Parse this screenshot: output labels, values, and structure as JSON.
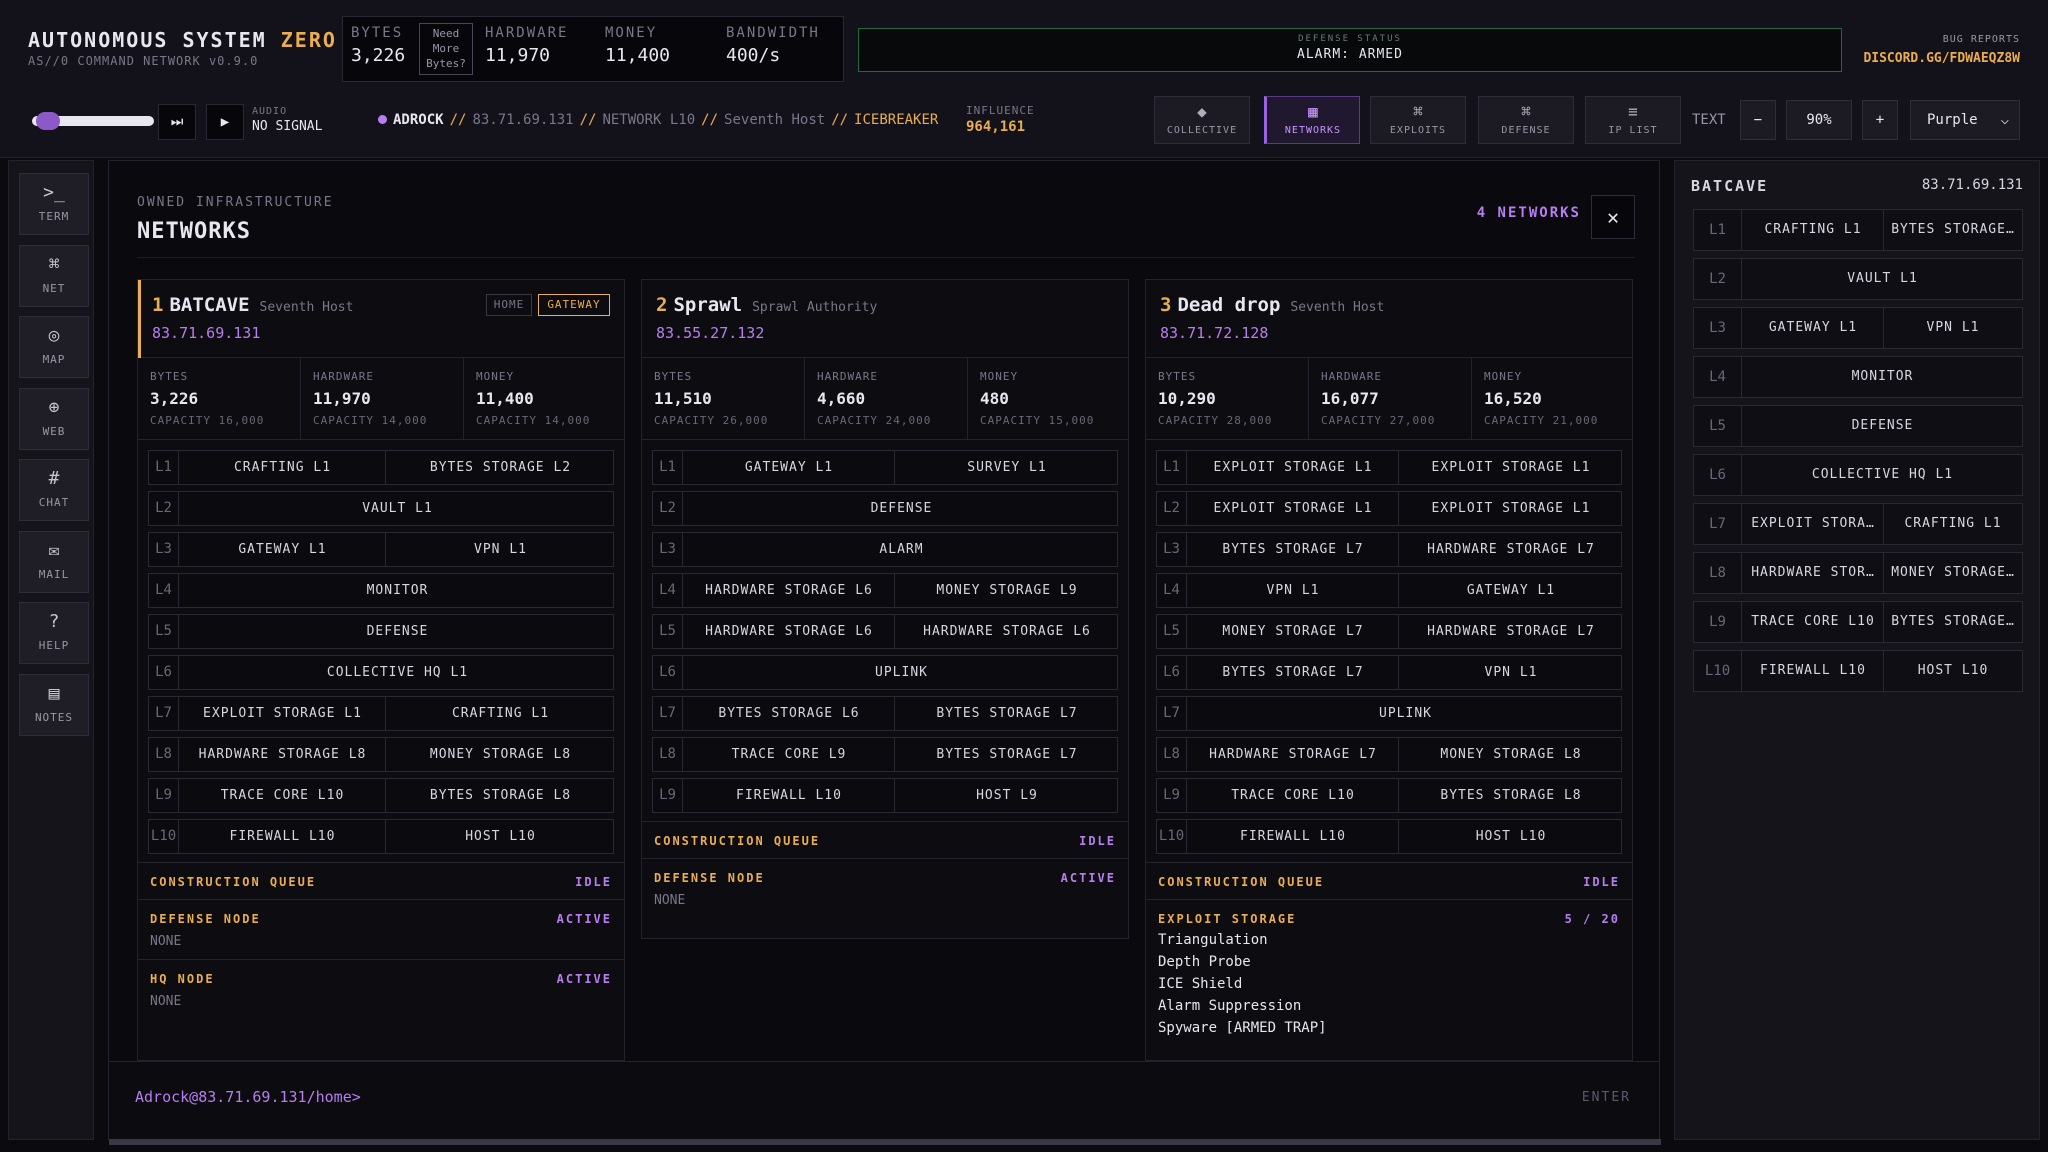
{
  "app": {
    "title": "AUTONOMOUS SYSTEM ",
    "title_accent": "ZERO",
    "subtitle": "AS//0 COMMAND NETWORK v0.9.0"
  },
  "resources": {
    "bytes_label": "BYTES",
    "bytes": "3,226",
    "need_bytes_l1": "Need",
    "need_bytes_l2": "More",
    "need_bytes_l3": "Bytes?",
    "hardware_label": "HARDWARE",
    "hardware": "11,970",
    "money_label": "MONEY",
    "money": "11,400",
    "bandwidth_label": "BANDWIDTH",
    "bandwidth": "400/s"
  },
  "defense_status": {
    "label": "DEFENSE STATUS",
    "value": "ALARM: ARMED"
  },
  "bug_reports": {
    "label": "BUG REPORTS",
    "value": "DISCORD.GG/FDWAEQZ8W"
  },
  "audio": {
    "label": "AUDIO",
    "value": "NO SIGNAL",
    "skip_icon": "⏭",
    "play_icon": "▶"
  },
  "breadcrumb": {
    "user": "ADROCK",
    "sep": "//",
    "ip": "83.71.69.131",
    "network": "NETWORK L10",
    "host": "Seventh Host",
    "tool": "ICEBREAKER"
  },
  "influence": {
    "label": "INFLUENCE",
    "value": "964,161"
  },
  "nav": [
    {
      "icon": "◆",
      "label": "COLLECTIVE"
    },
    {
      "icon": "▦",
      "label": "NETWORKS"
    },
    {
      "icon": "⌘",
      "label": "EXPLOITS"
    },
    {
      "icon": "⌘",
      "label": "DEFENSE"
    },
    {
      "icon": "≡",
      "label": "IP LIST"
    }
  ],
  "text_controls": {
    "label": "TEXT",
    "minus": "−",
    "zoom": "90%",
    "plus": "+"
  },
  "theme": {
    "value": "Purple",
    "chevron": "⌵"
  },
  "sidebar": [
    {
      "icon": ">_",
      "label": "TERM"
    },
    {
      "icon": "⌘",
      "label": "NET"
    },
    {
      "icon": "◎",
      "label": "MAP"
    },
    {
      "icon": "⊕",
      "label": "WEB"
    },
    {
      "icon": "#",
      "label": "CHAT"
    },
    {
      "icon": "✉",
      "label": "MAIL"
    },
    {
      "icon": "?",
      "label": "HELP"
    },
    {
      "icon": "▤",
      "label": "NOTES"
    }
  ],
  "main": {
    "kicker": "OWNED INFRASTRUCTURE",
    "title": "NETWORKS",
    "count": "4 NETWORKS",
    "close": "✕",
    "networks": [
      {
        "num": "1",
        "name": "BATCAVE",
        "host": "Seventh Host",
        "ip": "83.71.69.131",
        "tag_home": "HOME",
        "tag_gateway": "GATEWAY",
        "stats": [
          {
            "label": "BYTES",
            "value": "3,226",
            "cap": "CAPACITY 16,000"
          },
          {
            "label": "HARDWARE",
            "value": "11,970",
            "cap": "CAPACITY 14,000"
          },
          {
            "label": "MONEY",
            "value": "11,400",
            "cap": "CAPACITY 14,000"
          }
        ],
        "layers": [
          {
            "lv": "L1",
            "slots": [
              "CRAFTING L1",
              "BYTES STORAGE L2"
            ]
          },
          {
            "lv": "L2",
            "slots": [
              "VAULT L1"
            ]
          },
          {
            "lv": "L3",
            "slots": [
              "GATEWAY L1",
              "VPN L1"
            ]
          },
          {
            "lv": "L4",
            "slots": [
              "MONITOR"
            ]
          },
          {
            "lv": "L5",
            "slots": [
              "DEFENSE"
            ]
          },
          {
            "lv": "L6",
            "slots": [
              "COLLECTIVE HQ L1"
            ]
          },
          {
            "lv": "L7",
            "slots": [
              "EXPLOIT STORAGE L1",
              "CRAFTING L1"
            ]
          },
          {
            "lv": "L8",
            "slots": [
              "HARDWARE STORAGE L8",
              "MONEY STORAGE L8"
            ]
          },
          {
            "lv": "L9",
            "slots": [
              "TRACE CORE L10",
              "BYTES STORAGE L8"
            ]
          },
          {
            "lv": "L10",
            "slots": [
              "FIREWALL L10",
              "HOST L10"
            ]
          }
        ],
        "sections": [
          {
            "title": "CONSTRUCTION QUEUE",
            "status": "IDLE"
          },
          {
            "title": "DEFENSE NODE",
            "status": "ACTIVE",
            "body": "NONE"
          },
          {
            "title": "HQ NODE",
            "status": "ACTIVE",
            "body": "NONE"
          }
        ]
      },
      {
        "num": "2",
        "name": "Sprawl",
        "host": "Sprawl Authority",
        "ip": "83.55.27.132",
        "stats": [
          {
            "label": "BYTES",
            "value": "11,510",
            "cap": "CAPACITY 26,000"
          },
          {
            "label": "HARDWARE",
            "value": "4,660",
            "cap": "CAPACITY 24,000"
          },
          {
            "label": "MONEY",
            "value": "480",
            "cap": "CAPACITY 15,000"
          }
        ],
        "layers": [
          {
            "lv": "L1",
            "slots": [
              "GATEWAY L1",
              "SURVEY L1"
            ]
          },
          {
            "lv": "L2",
            "slots": [
              "DEFENSE"
            ]
          },
          {
            "lv": "L3",
            "slots": [
              "ALARM"
            ]
          },
          {
            "lv": "L4",
            "slots": [
              "HARDWARE STORAGE L6",
              "MONEY STORAGE L9"
            ]
          },
          {
            "lv": "L5",
            "slots": [
              "HARDWARE STORAGE L6",
              "HARDWARE STORAGE L6"
            ]
          },
          {
            "lv": "L6",
            "slots": [
              "UPLINK"
            ]
          },
          {
            "lv": "L7",
            "slots": [
              "BYTES STORAGE L6",
              "BYTES STORAGE L7"
            ]
          },
          {
            "lv": "L8",
            "slots": [
              "TRACE CORE L9",
              "BYTES STORAGE L7"
            ]
          },
          {
            "lv": "L9",
            "slots": [
              "FIREWALL L10",
              "HOST L9"
            ]
          }
        ],
        "sections": [
          {
            "title": "CONSTRUCTION QUEUE",
            "status": "IDLE"
          },
          {
            "title": "DEFENSE NODE",
            "status": "ACTIVE",
            "body": "NONE"
          }
        ]
      },
      {
        "num": "3",
        "name": "Dead drop",
        "host": "Seventh Host",
        "ip": "83.71.72.128",
        "stats": [
          {
            "label": "BYTES",
            "value": "10,290",
            "cap": "CAPACITY 28,000"
          },
          {
            "label": "HARDWARE",
            "value": "16,077",
            "cap": "CAPACITY 27,000"
          },
          {
            "label": "MONEY",
            "value": "16,520",
            "cap": "CAPACITY 21,000"
          }
        ],
        "layers": [
          {
            "lv": "L1",
            "slots": [
              "EXPLOIT STORAGE L1",
              "EXPLOIT STORAGE L1"
            ]
          },
          {
            "lv": "L2",
            "slots": [
              "EXPLOIT STORAGE L1",
              "EXPLOIT STORAGE L1"
            ]
          },
          {
            "lv": "L3",
            "slots": [
              "BYTES STORAGE L7",
              "HARDWARE STORAGE L7"
            ]
          },
          {
            "lv": "L4",
            "slots": [
              "VPN L1",
              "GATEWAY L1"
            ]
          },
          {
            "lv": "L5",
            "slots": [
              "MONEY STORAGE L7",
              "HARDWARE STORAGE L7"
            ]
          },
          {
            "lv": "L6",
            "slots": [
              "BYTES STORAGE L7",
              "VPN L1"
            ]
          },
          {
            "lv": "L7",
            "slots": [
              "UPLINK"
            ]
          },
          {
            "lv": "L8",
            "slots": [
              "HARDWARE STORAGE L7",
              "MONEY STORAGE L8"
            ]
          },
          {
            "lv": "L9",
            "slots": [
              "TRACE CORE L10",
              "BYTES STORAGE L8"
            ]
          },
          {
            "lv": "L10",
            "slots": [
              "FIREWALL L10",
              "HOST L10"
            ]
          }
        ],
        "sections": [
          {
            "title": "CONSTRUCTION QUEUE",
            "status": "IDLE"
          },
          {
            "title": "EXPLOIT STORAGE",
            "status": "5 / 20",
            "items": [
              "Triangulation",
              "Depth Probe",
              "ICE Shield",
              "Alarm Suppression",
              "Spyware [ARMED TRAP]"
            ]
          }
        ]
      }
    ],
    "prompt": "Adrock@83.71.69.131/home>",
    "enter": "ENTER"
  },
  "right_panel": {
    "title": "BATCAVE",
    "ip": "83.71.69.131",
    "layers": [
      {
        "lv": "L1",
        "slots": [
          "CRAFTING L1",
          "BYTES STORAGE…"
        ]
      },
      {
        "lv": "L2",
        "slots": [
          "VAULT L1"
        ]
      },
      {
        "lv": "L3",
        "slots": [
          "GATEWAY L1",
          "VPN L1"
        ]
      },
      {
        "lv": "L4",
        "slots": [
          "MONITOR"
        ]
      },
      {
        "lv": "L5",
        "slots": [
          "DEFENSE"
        ]
      },
      {
        "lv": "L6",
        "slots": [
          "COLLECTIVE HQ L1"
        ]
      },
      {
        "lv": "L7",
        "slots": [
          "EXPLOIT STORA…",
          "CRAFTING L1"
        ]
      },
      {
        "lv": "L8",
        "slots": [
          "HARDWARE STOR…",
          "MONEY STORAGE…"
        ]
      },
      {
        "lv": "L9",
        "slots": [
          "TRACE CORE L10",
          "BYTES STORAGE…"
        ]
      },
      {
        "lv": "L10",
        "slots": [
          "FIREWALL L10",
          "HOST L10"
        ]
      }
    ]
  }
}
